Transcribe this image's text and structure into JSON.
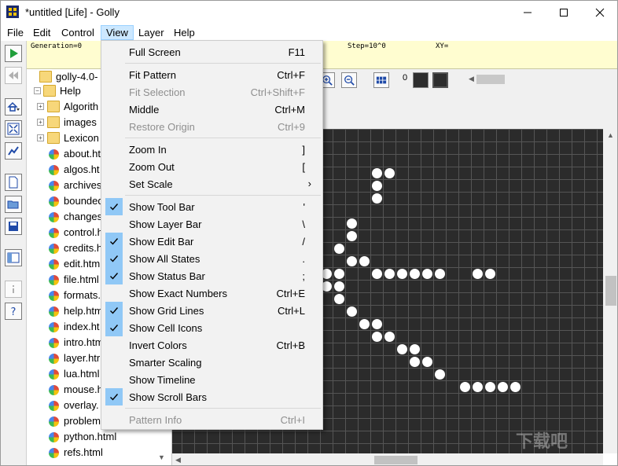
{
  "window": {
    "title": "*untitled [Life] - Golly"
  },
  "menubar": [
    "File",
    "Edit",
    "Control",
    "View",
    "Layer",
    "Help"
  ],
  "status": {
    "generation": "Generation=0",
    "step": "Step=10^0",
    "xy": "XY="
  },
  "tree": {
    "root": "golly-4.0-",
    "help": "Help",
    "items": [
      {
        "label": "Algorith",
        "type": "folder"
      },
      {
        "label": "images",
        "type": "folder"
      },
      {
        "label": "Lexicon",
        "type": "folder"
      },
      {
        "label": "about.ht",
        "type": "file"
      },
      {
        "label": "algos.ht",
        "type": "file"
      },
      {
        "label": "archives",
        "type": "file"
      },
      {
        "label": "bounded",
        "type": "file"
      },
      {
        "label": "changes",
        "type": "file"
      },
      {
        "label": "control.h",
        "type": "file"
      },
      {
        "label": "credits.h",
        "type": "file"
      },
      {
        "label": "edit.htm",
        "type": "file"
      },
      {
        "label": "file.html",
        "type": "file"
      },
      {
        "label": "formats.",
        "type": "file"
      },
      {
        "label": "help.htm",
        "type": "file"
      },
      {
        "label": "index.ht",
        "type": "file"
      },
      {
        "label": "intro.htm",
        "type": "file"
      },
      {
        "label": "layer.htr",
        "type": "file"
      },
      {
        "label": "lua.html",
        "type": "file"
      },
      {
        "label": "mouse.h",
        "type": "file"
      },
      {
        "label": "overlay.",
        "type": "file"
      },
      {
        "label": "problem",
        "type": "file"
      },
      {
        "label": "python.html",
        "type": "file"
      },
      {
        "label": "refs.html",
        "type": "file"
      }
    ]
  },
  "editbar": {
    "state": "0"
  },
  "viewmenu": [
    {
      "label": "Full Screen",
      "shortcut": "F11"
    },
    {
      "sep": true
    },
    {
      "label": "Fit Pattern",
      "shortcut": "Ctrl+F"
    },
    {
      "label": "Fit Selection",
      "shortcut": "Ctrl+Shift+F",
      "disabled": true
    },
    {
      "label": "Middle",
      "shortcut": "Ctrl+M"
    },
    {
      "label": "Restore Origin",
      "shortcut": "Ctrl+9",
      "disabled": true
    },
    {
      "sep": true
    },
    {
      "label": "Zoom In",
      "shortcut": "]"
    },
    {
      "label": "Zoom Out",
      "shortcut": "["
    },
    {
      "label": "Set Scale",
      "submenu": true
    },
    {
      "sep": true
    },
    {
      "label": "Show Tool Bar",
      "shortcut": "'",
      "checked": true
    },
    {
      "label": "Show Layer Bar",
      "shortcut": "\\"
    },
    {
      "label": "Show Edit Bar",
      "shortcut": "/",
      "checked": true
    },
    {
      "label": "Show All States",
      "shortcut": ".",
      "checked": true
    },
    {
      "label": "Show Status Bar",
      "shortcut": ";",
      "checked": true
    },
    {
      "label": "Show Exact Numbers",
      "shortcut": "Ctrl+E"
    },
    {
      "label": "Show Grid Lines",
      "shortcut": "Ctrl+L",
      "checked": true
    },
    {
      "label": "Show Cell Icons",
      "checked": true
    },
    {
      "label": "Invert Colors",
      "shortcut": "Ctrl+B"
    },
    {
      "label": "Smarter Scaling"
    },
    {
      "label": "Show Timeline"
    },
    {
      "label": "Show Scroll Bars",
      "checked": true
    },
    {
      "sep": true
    },
    {
      "label": "Pattern Info",
      "shortcut": "Ctrl+I",
      "disabled": true
    }
  ],
  "grid": {
    "cell_color": "#ffffff",
    "background": "#2b2b2b",
    "line_color": "#555555",
    "live_cells": [
      [
        16,
        3
      ],
      [
        17,
        3
      ],
      [
        16,
        4
      ],
      [
        16,
        5
      ],
      [
        14,
        7
      ],
      [
        14,
        8
      ],
      [
        13,
        9
      ],
      [
        14,
        10
      ],
      [
        15,
        10
      ],
      [
        12,
        11
      ],
      [
        13,
        11
      ],
      [
        16,
        11
      ],
      [
        17,
        11
      ],
      [
        18,
        11
      ],
      [
        19,
        11
      ],
      [
        20,
        11
      ],
      [
        21,
        11
      ],
      [
        24,
        11
      ],
      [
        25,
        11
      ],
      [
        12,
        12
      ],
      [
        13,
        12
      ],
      [
        13,
        13
      ],
      [
        14,
        14
      ],
      [
        15,
        15
      ],
      [
        16,
        15
      ],
      [
        16,
        16
      ],
      [
        17,
        16
      ],
      [
        18,
        17
      ],
      [
        19,
        17
      ],
      [
        19,
        18
      ],
      [
        20,
        18
      ],
      [
        21,
        19
      ],
      [
        23,
        20
      ],
      [
        24,
        20
      ],
      [
        25,
        20
      ],
      [
        26,
        20
      ],
      [
        27,
        20
      ]
    ]
  },
  "watermark": "下载吧"
}
